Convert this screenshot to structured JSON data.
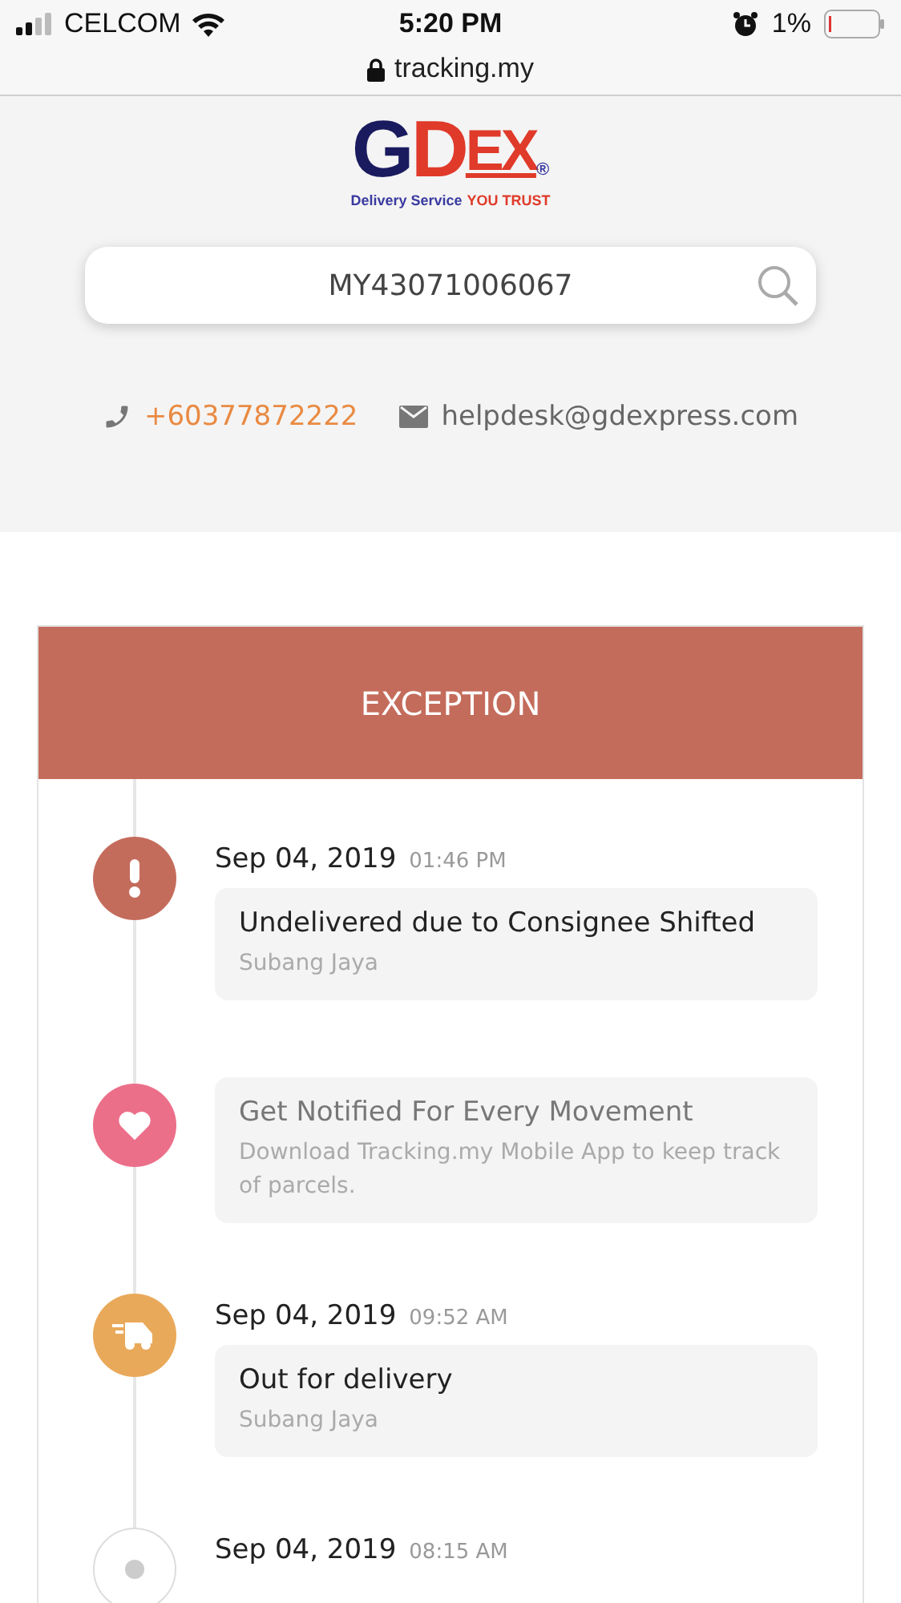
{
  "status_bar": {
    "carrier": "CELCOM",
    "time": "5:20 PM",
    "battery": "1%"
  },
  "address_bar": {
    "url": "tracking.my"
  },
  "logo": {
    "letters": [
      {
        "text": "G",
        "color": "#1a1a5e"
      },
      {
        "text": "D",
        "color": "#e03a2a"
      },
      {
        "text": "EX",
        "color": "#e03a2a"
      }
    ],
    "registered": "®",
    "tagline": [
      {
        "text": "Delivery Service",
        "color": "#3a3aa0"
      },
      {
        "text": "YOU TRUST",
        "color": "#e03a2a"
      }
    ]
  },
  "search": {
    "value": "MY43071006067"
  },
  "contacts": [
    {
      "kind": "phone",
      "text": "+60377872222"
    },
    {
      "kind": "email",
      "text": "helpdesk@gdexpress.com"
    }
  ],
  "status_header": {
    "text": "EXCEPTION"
  },
  "events": [
    {
      "kind": "exception",
      "color": "#c46c5c",
      "date": "Sep 04, 2019",
      "time": "01:46 PM",
      "title": "Undelivered due to Consignee Shifted",
      "detail": "Subang Jaya"
    },
    {
      "kind": "promo",
      "color": "#ec6f8a",
      "title": "Get Notified For Every Movement",
      "detail": "Download Tracking.my Mobile App to keep track of parcels."
    },
    {
      "kind": "delivery",
      "color": "#e9a95a",
      "date": "Sep 04, 2019",
      "time": "09:52 AM",
      "title": "Out for delivery",
      "detail": "Subang Jaya"
    },
    {
      "kind": "pending",
      "color": "#ffffff",
      "date": "Sep 04, 2019",
      "time": "08:15 AM"
    }
  ]
}
